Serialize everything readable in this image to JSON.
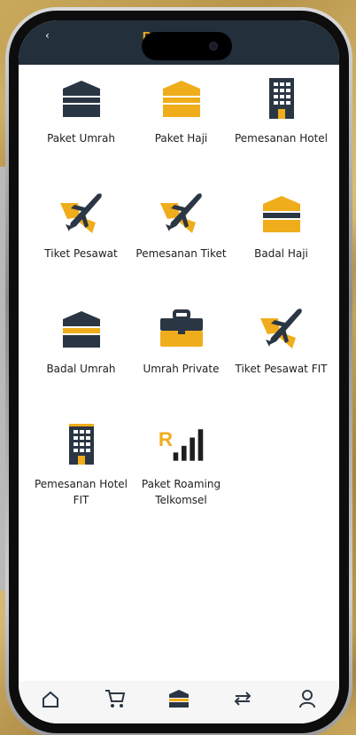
{
  "header": {
    "title": "Pesan Baru",
    "back_glyph": "‹"
  },
  "colors": {
    "header_bg": "#232f3b",
    "accent": "#f0ad1b",
    "dark_icon": "#2b3644"
  },
  "menu": [
    {
      "label": "Paket Umrah",
      "icon": "kaaba-dark-icon"
    },
    {
      "label": "Paket Haji",
      "icon": "kaaba-yellow-icon"
    },
    {
      "label": "Pemesanan Hotel",
      "icon": "hotel-icon"
    },
    {
      "label": "Tiket Pesawat",
      "icon": "airplane-icon"
    },
    {
      "label": "Pemesanan Tiket",
      "icon": "airplane-icon"
    },
    {
      "label": "Badal Haji",
      "icon": "kaaba-yellow-icon"
    },
    {
      "label": "Badal Umrah",
      "icon": "kaaba-dark-icon"
    },
    {
      "label": "Umrah Private",
      "icon": "briefcase-icon"
    },
    {
      "label": "Tiket Pesawat FIT",
      "icon": "airplane-icon"
    },
    {
      "label": "Pemesanan Hotel FIT",
      "icon": "hotel-icon"
    },
    {
      "label": "Paket Roaming Telkomsel",
      "icon": "roaming-signal-icon"
    }
  ],
  "bottom_nav": [
    {
      "icon": "home-icon"
    },
    {
      "icon": "cart-icon"
    },
    {
      "icon": "kaaba-nav-icon",
      "active": true
    },
    {
      "icon": "transfer-icon"
    },
    {
      "icon": "profile-icon"
    }
  ],
  "roaming_letter": "R"
}
